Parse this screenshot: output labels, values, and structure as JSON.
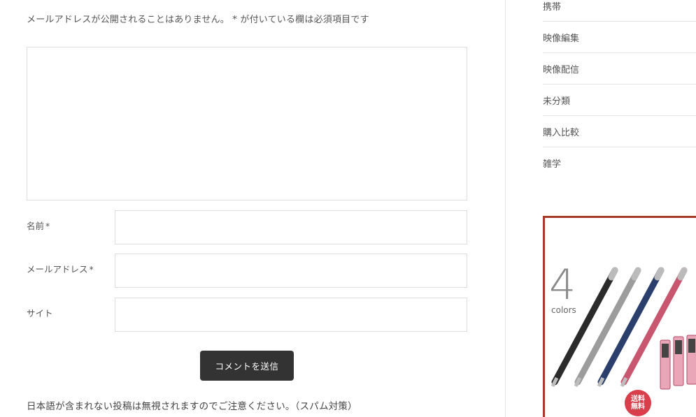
{
  "comment_form": {
    "notice": "メールアドレスが公開されることはありません。 * が付いている欄は必須項目です",
    "comment_value": "",
    "fields": [
      {
        "label": "名前",
        "required_mark": "*",
        "value": ""
      },
      {
        "label": "メールアドレス",
        "required_mark": "*",
        "value": ""
      },
      {
        "label": "サイト",
        "required_mark": "",
        "value": ""
      }
    ],
    "submit_label": "コメントを送信",
    "spam_note": "日本語が含まれない投稿は無視されますのでご注意ください。（スパム対策）"
  },
  "sidebar": {
    "categories": [
      "携帯",
      "映像編集",
      "映像配信",
      "未分類",
      "購入比較",
      "雑学"
    ],
    "ad": {
      "number": "4",
      "subtitle": "colors",
      "badge_line1": "送料",
      "badge_line2": "無料",
      "border_color": "#a83a2a",
      "badge_color": "#d93e4b",
      "pen_colors": [
        "#2b2b2b",
        "#9c9c9c",
        "#2a3f6b",
        "#c9566f"
      ]
    }
  },
  "colors": {
    "button_bg": "#333333",
    "border": "#dddddd"
  }
}
